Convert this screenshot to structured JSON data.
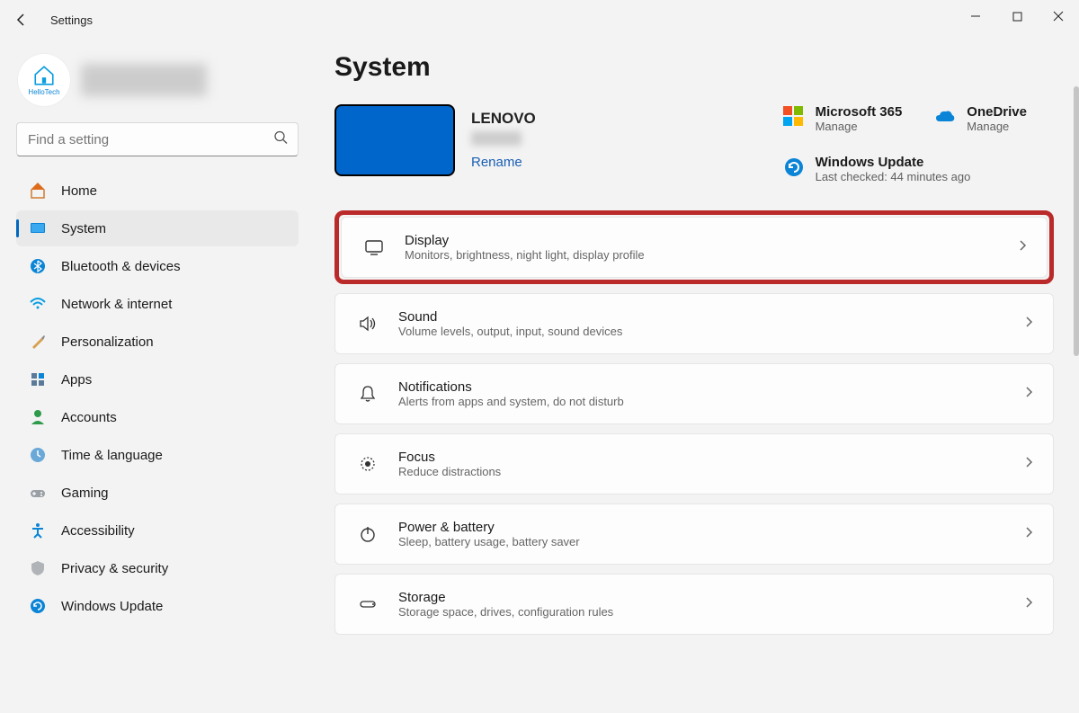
{
  "window": {
    "title": "Settings"
  },
  "avatar": {
    "label": "HelloTech"
  },
  "search": {
    "placeholder": "Find a setting"
  },
  "nav": {
    "home": "Home",
    "system": "System",
    "bluetooth": "Bluetooth & devices",
    "network": "Network & internet",
    "personalization": "Personalization",
    "apps": "Apps",
    "accounts": "Accounts",
    "time": "Time & language",
    "gaming": "Gaming",
    "accessibility": "Accessibility",
    "privacy": "Privacy & security",
    "update": "Windows Update"
  },
  "page": {
    "title": "System"
  },
  "device": {
    "name": "LENOVO",
    "rename": "Rename"
  },
  "services": {
    "ms365": {
      "title": "Microsoft 365",
      "action": "Manage"
    },
    "onedrive": {
      "title": "OneDrive",
      "action": "Manage"
    },
    "update": {
      "title": "Windows Update",
      "subtitle": "Last checked: 44 minutes ago"
    }
  },
  "cards": {
    "display": {
      "title": "Display",
      "subtitle": "Monitors, brightness, night light, display profile"
    },
    "sound": {
      "title": "Sound",
      "subtitle": "Volume levels, output, input, sound devices"
    },
    "notifications": {
      "title": "Notifications",
      "subtitle": "Alerts from apps and system, do not disturb"
    },
    "focus": {
      "title": "Focus",
      "subtitle": "Reduce distractions"
    },
    "power": {
      "title": "Power & battery",
      "subtitle": "Sleep, battery usage, battery saver"
    },
    "storage": {
      "title": "Storage",
      "subtitle": "Storage space, drives, configuration rules"
    }
  }
}
